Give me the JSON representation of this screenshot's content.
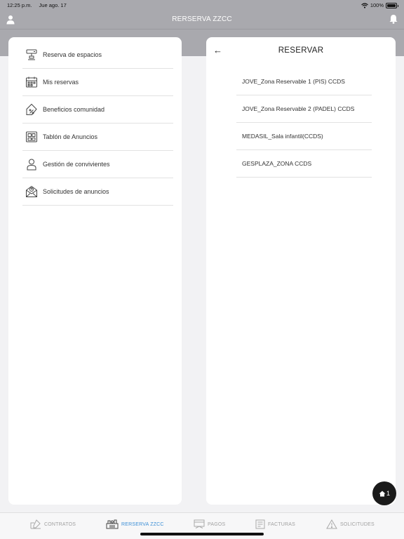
{
  "status_bar": {
    "time": "12:25 p.m.",
    "date": "Jue ago. 17",
    "battery": "100%"
  },
  "header": {
    "title": "RERSERVA ZZCC"
  },
  "menu": {
    "items": [
      {
        "label": "Reserva de espacios",
        "icon": "space-booking-icon"
      },
      {
        "label": "Mis reservas",
        "icon": "calendar-icon"
      },
      {
        "label": "Beneficios comunidad",
        "icon": "discount-tag-icon"
      },
      {
        "label": "Tablón de Anuncios",
        "icon": "noticeboard-icon"
      },
      {
        "label": "Gestión de convivientes",
        "icon": "person-icon"
      },
      {
        "label": "Solicitudes de anuncios",
        "icon": "mail-question-icon"
      }
    ]
  },
  "reserve": {
    "back": "←",
    "title": "RESERVAR",
    "zones": [
      "JOVE_Zona Reservable 1 (PIS) CCDS",
      "JOVE_Zona Reservable 2 (PADEL) CCDS",
      "MEDASIL_Sala infantil(CCDS)",
      "GESPLAZA_ZONA CCDS"
    ]
  },
  "fab": {
    "count": "1"
  },
  "tabbar": {
    "tabs": [
      {
        "label": "CONTRATOS",
        "icon": "contracts-icon",
        "active": false
      },
      {
        "label": "RERSERVA ZZCC",
        "icon": "community-zones-icon",
        "active": true
      },
      {
        "label": "PAGOS",
        "icon": "payments-icon",
        "active": false
      },
      {
        "label": "FACTURAS",
        "icon": "invoices-icon",
        "active": false
      },
      {
        "label": "SOLICITUDES",
        "icon": "warning-icon",
        "active": false
      }
    ]
  },
  "colors": {
    "header_bg": "#a9a9ae",
    "accent": "#3d8fd6",
    "fab_bg": "#1a1a1a"
  }
}
